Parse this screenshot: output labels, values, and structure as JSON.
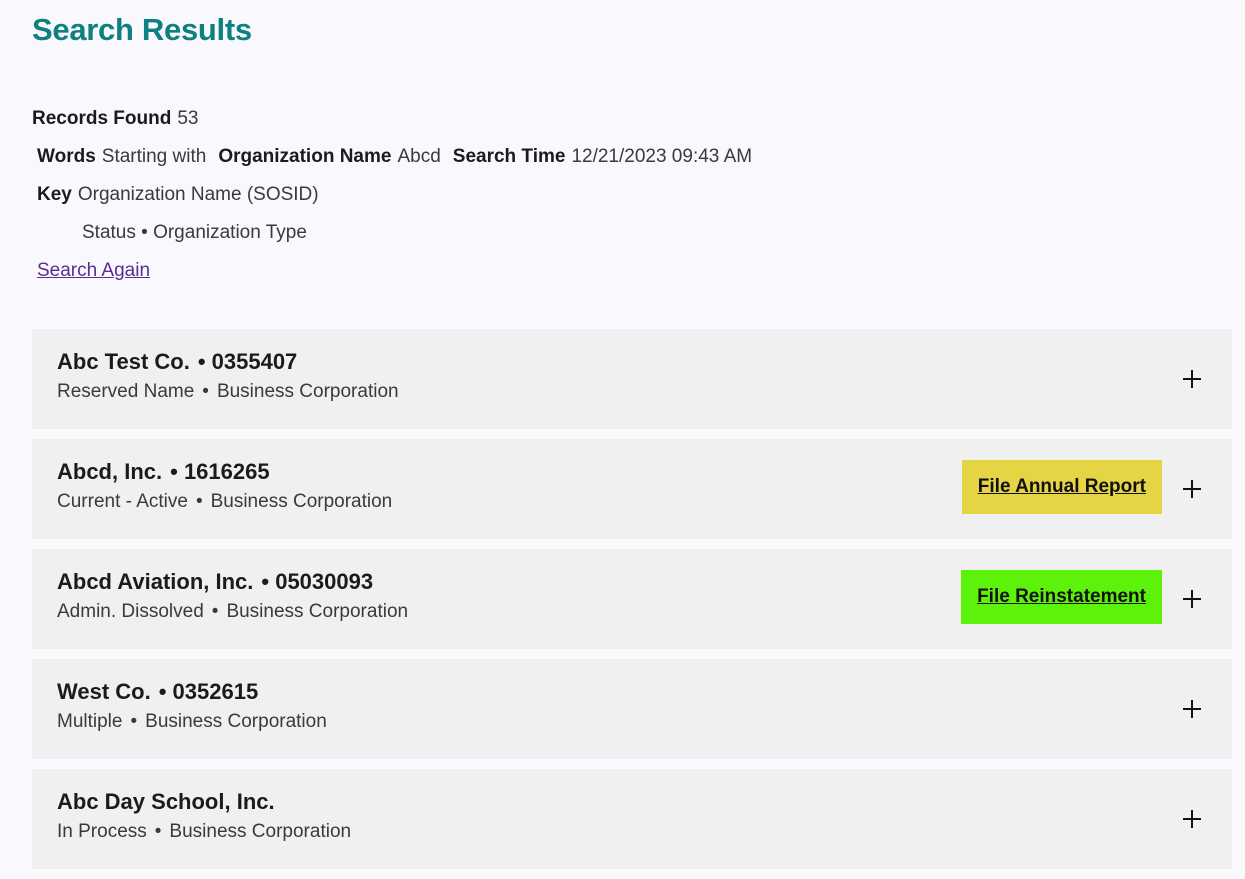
{
  "page": {
    "title": "Search Results"
  },
  "summary": {
    "records_found_label": "Records Found",
    "records_found_value": "53",
    "words_label": "Words",
    "words_value": "Starting with",
    "org_name_label": "Organization Name",
    "org_name_value": "Abcd",
    "search_time_label": "Search Time",
    "search_time_value": "12/21/2023 09:43 AM",
    "key_label": "Key",
    "key_line1": "Organization Name (SOSID)",
    "key_line2": "Status • Organization Type",
    "search_again_label": "Search Again"
  },
  "results": [
    {
      "name": "Abc Test Co.",
      "sosid": "• 0355407",
      "status": "Reserved Name",
      "dot": "•",
      "type": "Business Corporation",
      "action": null,
      "action_color": null,
      "expand_icon": "plus-icon"
    },
    {
      "name": "Abcd, Inc.",
      "sosid": "• 1616265",
      "status": "Current - Active",
      "dot": "•",
      "type": "Business Corporation",
      "action": "File Annual Report",
      "action_color": "#e5d544",
      "expand_icon": "plus-icon"
    },
    {
      "name": "Abcd Aviation, Inc.",
      "sosid": "• 05030093",
      "status": "Admin. Dissolved",
      "dot": "•",
      "type": "Business Corporation",
      "action": "File Reinstatement",
      "action_color": "#5cf20a",
      "expand_icon": "plus-icon"
    },
    {
      "name": "West Co.",
      "sosid": "• 0352615",
      "status": "Multiple",
      "dot": "•",
      "type": "Business Corporation",
      "action": null,
      "action_color": null,
      "expand_icon": "plus-icon"
    },
    {
      "name": "Abc Day School, Inc.",
      "sosid": "",
      "status": "In Process",
      "dot": "•",
      "type": "Business Corporation",
      "action": null,
      "action_color": null,
      "expand_icon": "plus-icon"
    }
  ]
}
